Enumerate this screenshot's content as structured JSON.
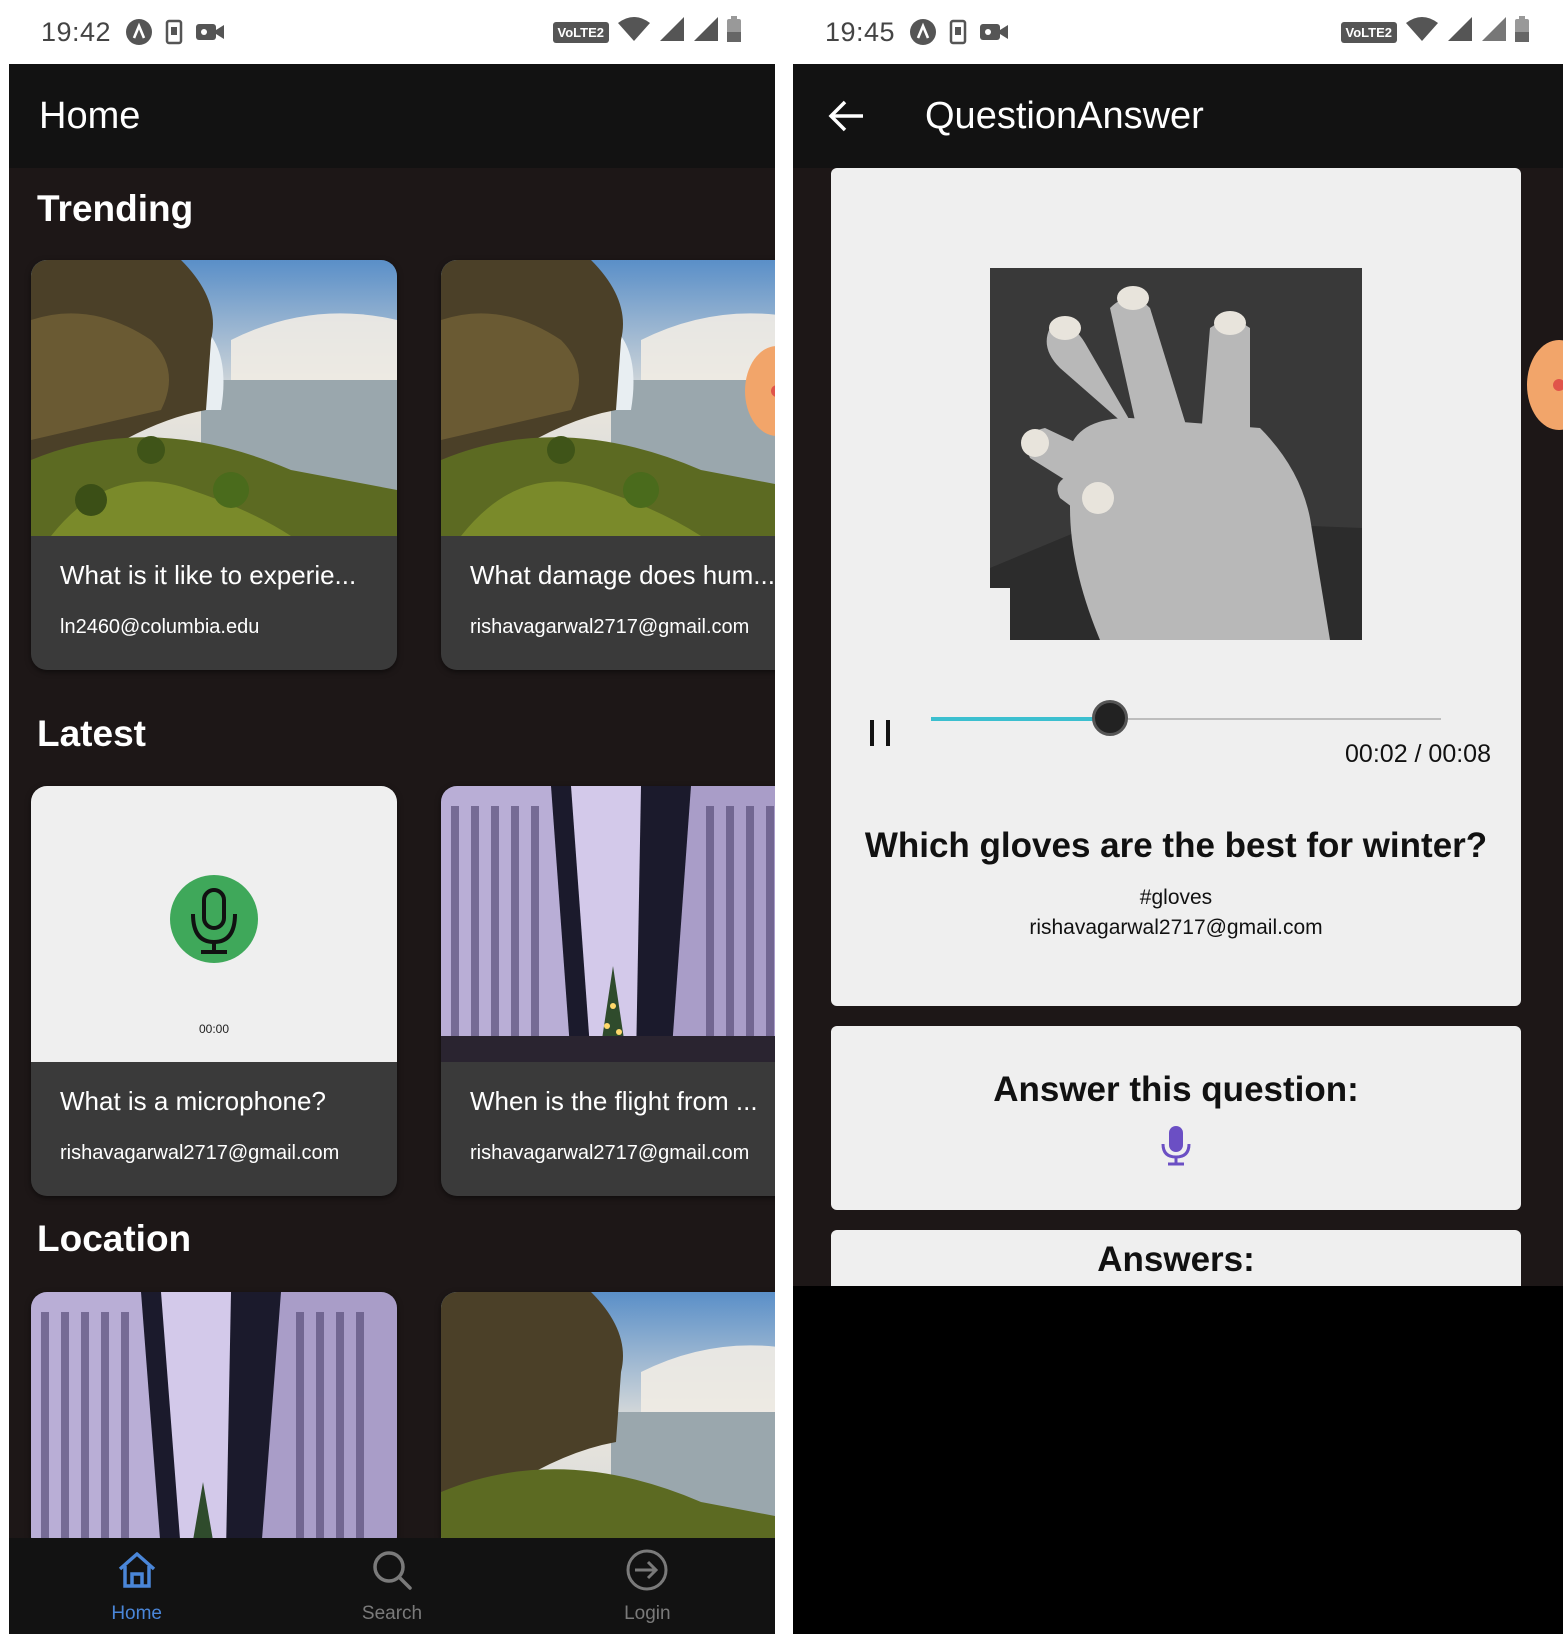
{
  "left": {
    "status": {
      "time": "19:42",
      "network": "VoLTE2"
    },
    "appbar": {
      "title": "Home"
    },
    "sections": {
      "trending": "Trending",
      "latest": "Latest",
      "location": "Location"
    },
    "trending_cards": [
      {
        "title": "What is it like to experie...",
        "email": "ln2460@columbia.edu"
      },
      {
        "title": "What damage does hum...",
        "email": "rishavagarwal2717@gmail.com"
      }
    ],
    "latest_cards": [
      {
        "title": "What is a microphone?",
        "email": "rishavagarwal2717@gmail.com",
        "audio_time": "00:00"
      },
      {
        "title": "When is the flight from ...",
        "email": "rishavagarwal2717@gmail.com"
      }
    ],
    "nav": {
      "home": "Home",
      "search": "Search",
      "login": "Login"
    }
  },
  "right": {
    "status": {
      "time": "19:45",
      "network": "VoLTE2"
    },
    "appbar": {
      "title": "QuestionAnswer"
    },
    "player": {
      "time_display": "00:02 / 00:08",
      "progress": 0.35
    },
    "question": {
      "text": "Which gloves are the best for winter?",
      "tag": "#gloves",
      "email": "rishavagarwal2717@gmail.com"
    },
    "answer_prompt": "Answer this question:",
    "answers_label": "Answers:"
  },
  "colors": {
    "accent_blue": "#4a86d8",
    "mic_green": "#3fa85a",
    "mic_purple": "#6b4fc4",
    "slider_teal": "#3bbfcf",
    "background_dark": "#1d1717"
  }
}
